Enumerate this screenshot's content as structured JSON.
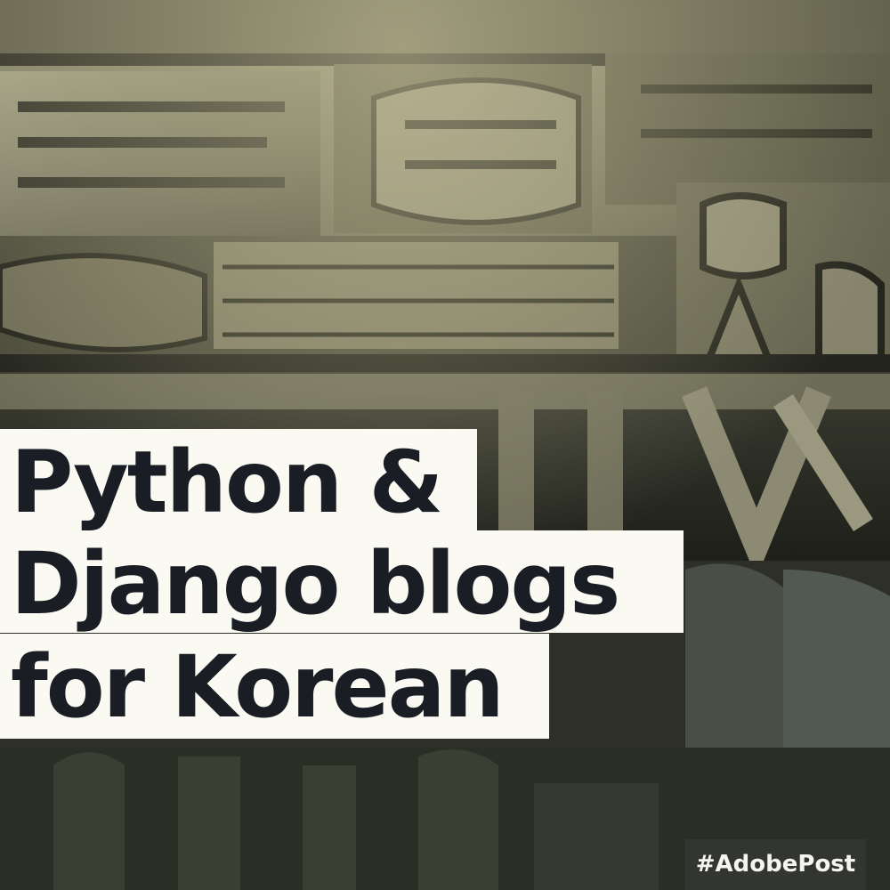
{
  "title": {
    "lines": [
      "Python &",
      "Django blogs",
      "for Korean"
    ]
  },
  "badge": {
    "hashtag": "#AdobePost"
  },
  "background": {
    "description_type": "letterpress-type-photo",
    "colors": {
      "base": "#2a2c22",
      "metal": "#6b6a55",
      "highlight": "#b8b49a",
      "shadow": "#14150f"
    }
  },
  "colors": {
    "title_bg": "#fafaf3",
    "title_text": "#1b1d24",
    "badge_bg": "#343734",
    "badge_text": "#f5f5f0"
  }
}
